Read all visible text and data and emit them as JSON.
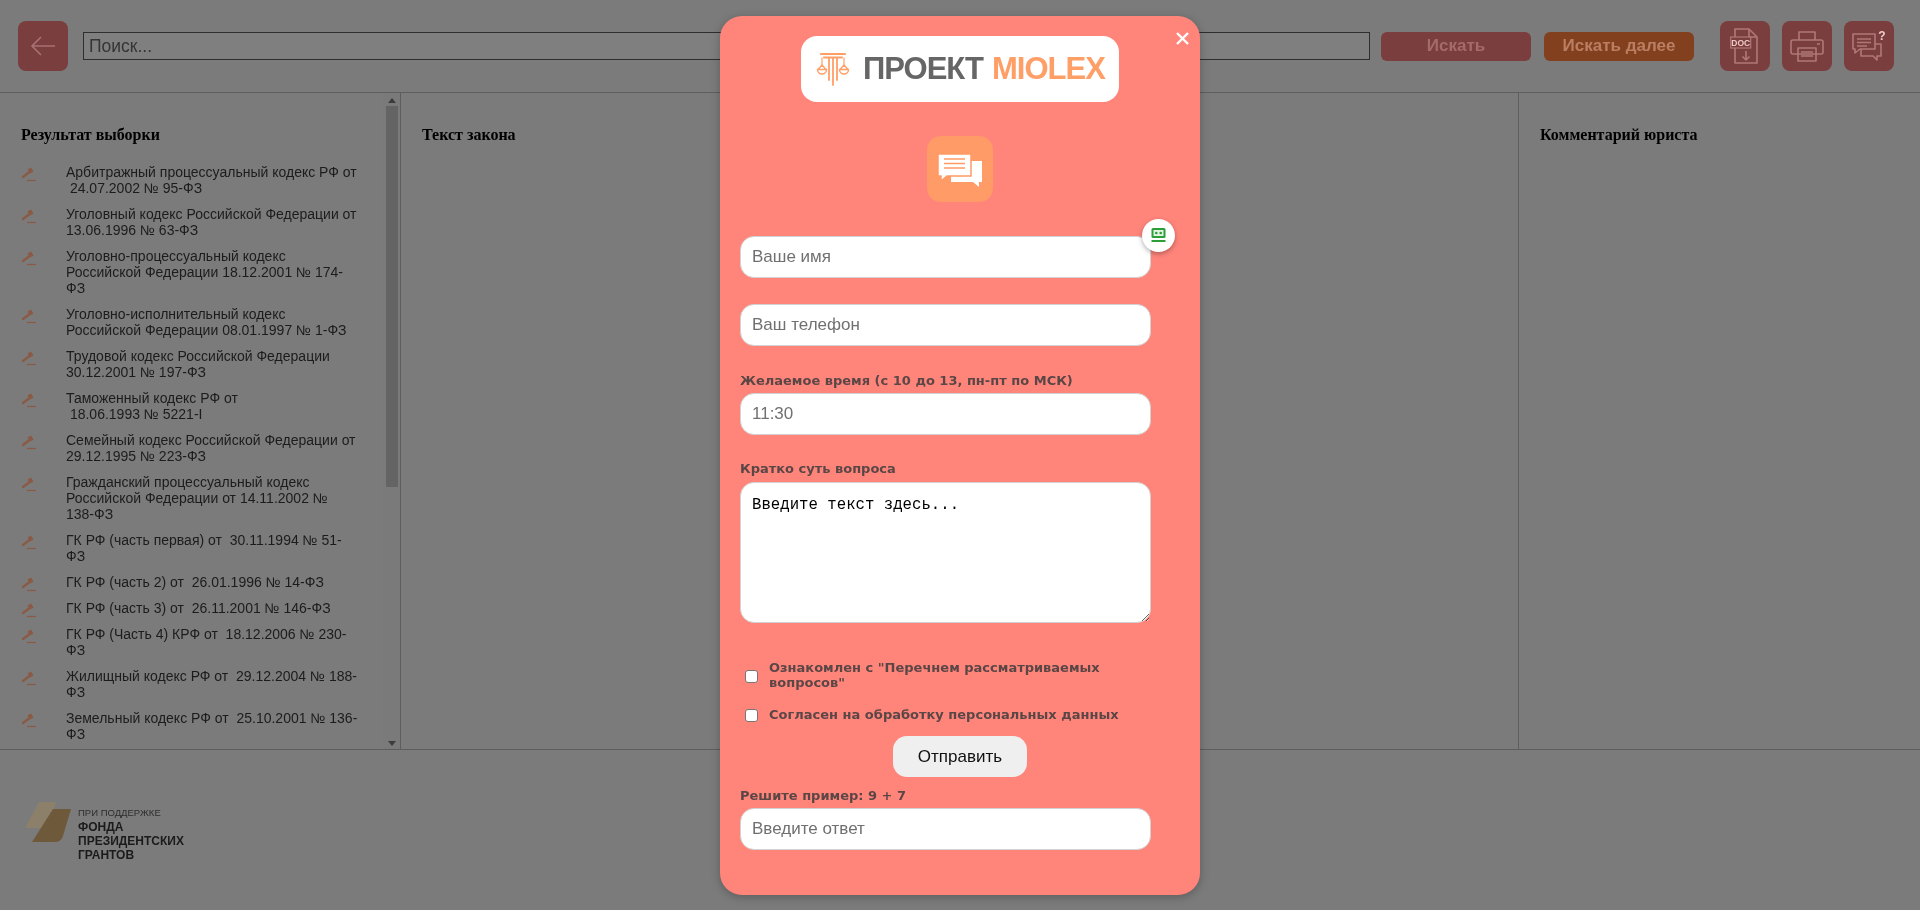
{
  "toolbar": {
    "search": {
      "placeholder": "Поиск..."
    },
    "buttons": [
      {
        "label": "Искать",
        "kind": "primary"
      },
      {
        "label": "Искать далее",
        "kind": "accent"
      }
    ],
    "icon_buttons": [
      {
        "kind": "doc",
        "label": "DOC"
      },
      {
        "kind": "print"
      },
      {
        "kind": "chat",
        "label": "?"
      }
    ]
  },
  "panels": [
    {
      "kind": "list",
      "title": "Результат выборки",
      "items": [
        "Арбитражный процессуальный кодекс РФ от  24.07.2002 № 95-ФЗ",
        "Уголовный кодекс Российской Федерации от 13.06.1996 № 63-ФЗ",
        "Уголовно-процессуальный кодекс Российской Федерации 18.12.2001 № 174-ФЗ",
        "Уголовно-исполнительный кодекс Российской Федерации 08.01.1997 № 1-ФЗ",
        "Трудовой кодекс Российской Федерации 30.12.2001 № 197-ФЗ",
        "Таможенный кодекс РФ от  18.06.1993 № 5221-I",
        "Семейный кодекс Российской Федерации от 29.12.1995 № 223-ФЗ",
        "Гражданский процессуальный кодекс Российской Федерации от 14.11.2002 № 138-ФЗ",
        "ГК РФ (часть первая) от  30.11.1994 № 51-ФЗ",
        "ГК РФ (часть 2) от  26.01.1996 № 14-ФЗ",
        "ГК РФ (часть 3) от  26.11.2001 № 146-ФЗ",
        "ГК РФ (Часть 4) КРФ от  18.12.2006 № 230-ФЗ",
        "Жилищный кодекс РФ от  29.12.2004 № 188-ФЗ",
        "Земельный кодекс РФ от  25.10.2001 № 136-ФЗ"
      ]
    },
    {
      "kind": "text",
      "title": "Текст закона"
    },
    {
      "kind": "text",
      "title": "Комментарий юриста"
    }
  ],
  "footer": {
    "caption": "ПРИ ПОДДЕРЖКЕ",
    "name": "ФОНДА ПРЕЗИДЕНТСКИХ ГРАНТОВ"
  },
  "modal": {
    "logo": {
      "title": "ПРОЕКТ",
      "brand": "MIOLEX"
    },
    "fields": [
      {
        "kind": "input",
        "placeholder": "Ваше имя"
      },
      {
        "kind": "input",
        "placeholder": "Ваш телефон"
      },
      {
        "kind": "input",
        "label": "Желаемое время (с 10 до 13, пн-пт по МСК)",
        "placeholder": "11:30"
      },
      {
        "kind": "textarea",
        "label": "Кратко суть вопроса",
        "value": "Введите текст здесь..."
      }
    ],
    "checkboxes": [
      {
        "label": "Ознакомлен с \"Перечнем рассматриваемых вопросов\"",
        "checked": false
      },
      {
        "label": "Согласен на обработку персональных данных",
        "checked": false
      }
    ],
    "submit": "Отправить",
    "captcha": {
      "label": "Решите пример: 9 + 7",
      "placeholder": "Введите ответ"
    }
  }
}
